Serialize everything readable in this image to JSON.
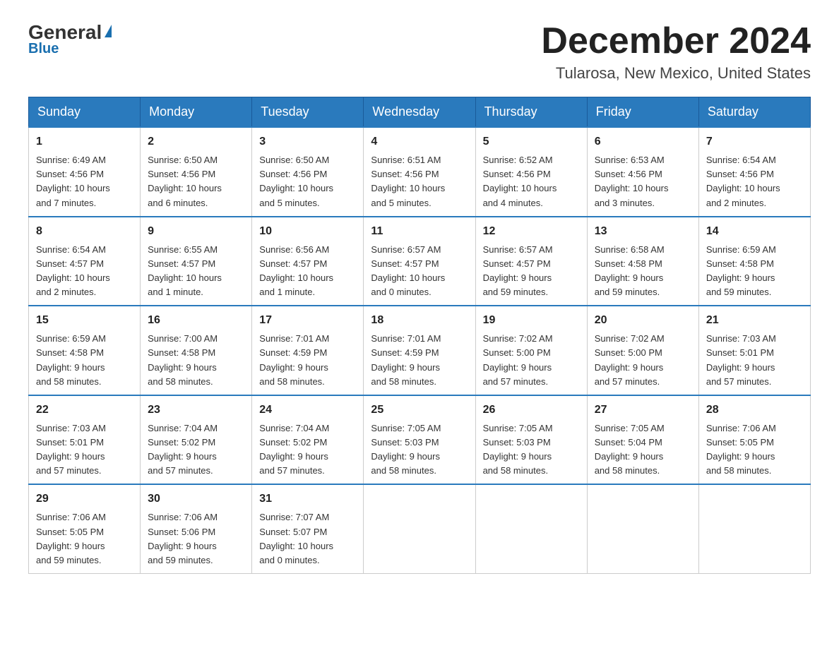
{
  "header": {
    "logo_general": "General",
    "logo_blue": "Blue",
    "page_title": "December 2024",
    "subtitle": "Tularosa, New Mexico, United States"
  },
  "calendar": {
    "headers": [
      "Sunday",
      "Monday",
      "Tuesday",
      "Wednesday",
      "Thursday",
      "Friday",
      "Saturday"
    ],
    "weeks": [
      [
        {
          "day": "1",
          "info": "Sunrise: 6:49 AM\nSunset: 4:56 PM\nDaylight: 10 hours\nand 7 minutes."
        },
        {
          "day": "2",
          "info": "Sunrise: 6:50 AM\nSunset: 4:56 PM\nDaylight: 10 hours\nand 6 minutes."
        },
        {
          "day": "3",
          "info": "Sunrise: 6:50 AM\nSunset: 4:56 PM\nDaylight: 10 hours\nand 5 minutes."
        },
        {
          "day": "4",
          "info": "Sunrise: 6:51 AM\nSunset: 4:56 PM\nDaylight: 10 hours\nand 5 minutes."
        },
        {
          "day": "5",
          "info": "Sunrise: 6:52 AM\nSunset: 4:56 PM\nDaylight: 10 hours\nand 4 minutes."
        },
        {
          "day": "6",
          "info": "Sunrise: 6:53 AM\nSunset: 4:56 PM\nDaylight: 10 hours\nand 3 minutes."
        },
        {
          "day": "7",
          "info": "Sunrise: 6:54 AM\nSunset: 4:56 PM\nDaylight: 10 hours\nand 2 minutes."
        }
      ],
      [
        {
          "day": "8",
          "info": "Sunrise: 6:54 AM\nSunset: 4:57 PM\nDaylight: 10 hours\nand 2 minutes."
        },
        {
          "day": "9",
          "info": "Sunrise: 6:55 AM\nSunset: 4:57 PM\nDaylight: 10 hours\nand 1 minute."
        },
        {
          "day": "10",
          "info": "Sunrise: 6:56 AM\nSunset: 4:57 PM\nDaylight: 10 hours\nand 1 minute."
        },
        {
          "day": "11",
          "info": "Sunrise: 6:57 AM\nSunset: 4:57 PM\nDaylight: 10 hours\nand 0 minutes."
        },
        {
          "day": "12",
          "info": "Sunrise: 6:57 AM\nSunset: 4:57 PM\nDaylight: 9 hours\nand 59 minutes."
        },
        {
          "day": "13",
          "info": "Sunrise: 6:58 AM\nSunset: 4:58 PM\nDaylight: 9 hours\nand 59 minutes."
        },
        {
          "day": "14",
          "info": "Sunrise: 6:59 AM\nSunset: 4:58 PM\nDaylight: 9 hours\nand 59 minutes."
        }
      ],
      [
        {
          "day": "15",
          "info": "Sunrise: 6:59 AM\nSunset: 4:58 PM\nDaylight: 9 hours\nand 58 minutes."
        },
        {
          "day": "16",
          "info": "Sunrise: 7:00 AM\nSunset: 4:58 PM\nDaylight: 9 hours\nand 58 minutes."
        },
        {
          "day": "17",
          "info": "Sunrise: 7:01 AM\nSunset: 4:59 PM\nDaylight: 9 hours\nand 58 minutes."
        },
        {
          "day": "18",
          "info": "Sunrise: 7:01 AM\nSunset: 4:59 PM\nDaylight: 9 hours\nand 58 minutes."
        },
        {
          "day": "19",
          "info": "Sunrise: 7:02 AM\nSunset: 5:00 PM\nDaylight: 9 hours\nand 57 minutes."
        },
        {
          "day": "20",
          "info": "Sunrise: 7:02 AM\nSunset: 5:00 PM\nDaylight: 9 hours\nand 57 minutes."
        },
        {
          "day": "21",
          "info": "Sunrise: 7:03 AM\nSunset: 5:01 PM\nDaylight: 9 hours\nand 57 minutes."
        }
      ],
      [
        {
          "day": "22",
          "info": "Sunrise: 7:03 AM\nSunset: 5:01 PM\nDaylight: 9 hours\nand 57 minutes."
        },
        {
          "day": "23",
          "info": "Sunrise: 7:04 AM\nSunset: 5:02 PM\nDaylight: 9 hours\nand 57 minutes."
        },
        {
          "day": "24",
          "info": "Sunrise: 7:04 AM\nSunset: 5:02 PM\nDaylight: 9 hours\nand 57 minutes."
        },
        {
          "day": "25",
          "info": "Sunrise: 7:05 AM\nSunset: 5:03 PM\nDaylight: 9 hours\nand 58 minutes."
        },
        {
          "day": "26",
          "info": "Sunrise: 7:05 AM\nSunset: 5:03 PM\nDaylight: 9 hours\nand 58 minutes."
        },
        {
          "day": "27",
          "info": "Sunrise: 7:05 AM\nSunset: 5:04 PM\nDaylight: 9 hours\nand 58 minutes."
        },
        {
          "day": "28",
          "info": "Sunrise: 7:06 AM\nSunset: 5:05 PM\nDaylight: 9 hours\nand 58 minutes."
        }
      ],
      [
        {
          "day": "29",
          "info": "Sunrise: 7:06 AM\nSunset: 5:05 PM\nDaylight: 9 hours\nand 59 minutes."
        },
        {
          "day": "30",
          "info": "Sunrise: 7:06 AM\nSunset: 5:06 PM\nDaylight: 9 hours\nand 59 minutes."
        },
        {
          "day": "31",
          "info": "Sunrise: 7:07 AM\nSunset: 5:07 PM\nDaylight: 10 hours\nand 0 minutes."
        },
        {
          "day": "",
          "info": ""
        },
        {
          "day": "",
          "info": ""
        },
        {
          "day": "",
          "info": ""
        },
        {
          "day": "",
          "info": ""
        }
      ]
    ]
  }
}
